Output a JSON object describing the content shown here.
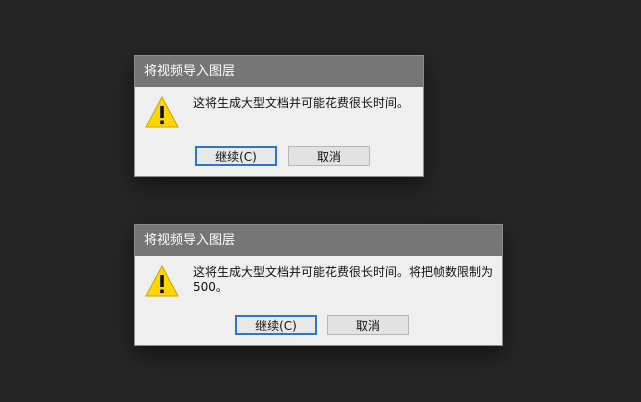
{
  "dialogs": [
    {
      "title": "将视频导入图层",
      "message": "这将生成大型文档并可能花费很长时间。",
      "continue_label": "继续(C)",
      "cancel_label": "取消",
      "icon": "warning-icon"
    },
    {
      "title": "将视频导入图层",
      "message": "这将生成大型文档并可能花费很长时间。将把帧数限制为\n500。",
      "continue_label": "继续(C)",
      "cancel_label": "取消",
      "icon": "warning-icon"
    }
  ],
  "colors": {
    "background": "#262626",
    "titlebar": "#767676",
    "dialog_body": "#efefef",
    "warning_yellow": "#ffd600",
    "primary_button_border": "#2a78c6"
  }
}
